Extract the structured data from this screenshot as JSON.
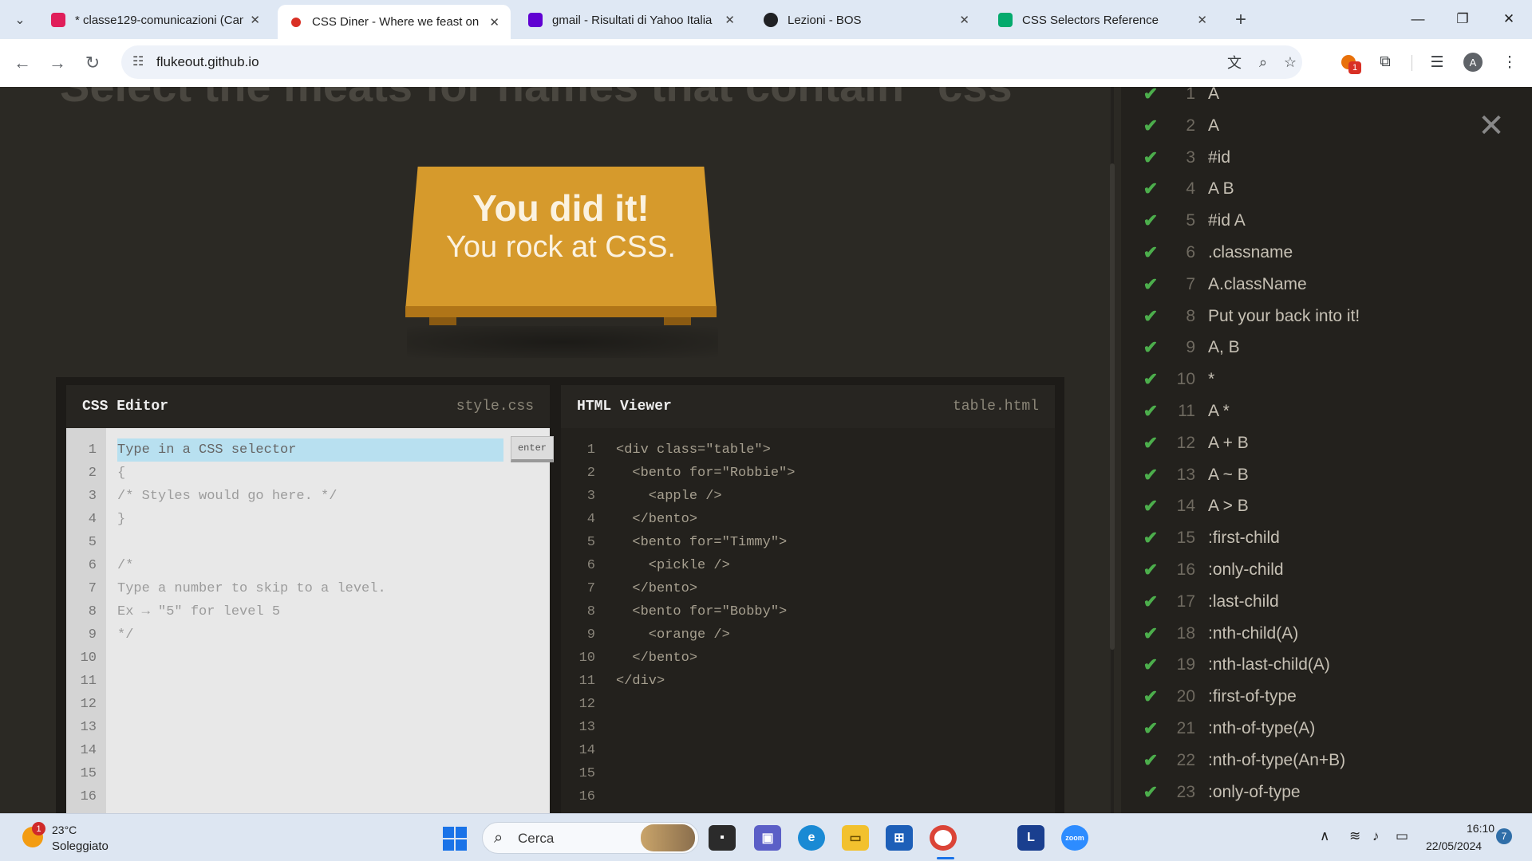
{
  "browser": {
    "tabs": [
      {
        "title": "* classe129-comunicazioni (Can",
        "icon": "slack-icon",
        "active": false
      },
      {
        "title": "CSS Diner - Where we feast on",
        "icon": "css-diner-icon",
        "active": true
      },
      {
        "title": "gmail - Risultati di Yahoo Italia",
        "icon": "yahoo-icon",
        "active": false
      },
      {
        "title": "Lezioni - BOS",
        "icon": "bos-icon",
        "active": false
      },
      {
        "title": "CSS Selectors Reference",
        "icon": "w3schools-icon",
        "active": false
      }
    ],
    "url": "flukeout.github.io",
    "extension_badge": "1",
    "profile_initial": "A"
  },
  "page": {
    "heading_fragment": "Select the meats for names that contain \"css\"",
    "win_title": "You did it!",
    "win_subtitle": "You rock at CSS.",
    "css_editor": {
      "label": "CSS Editor",
      "file": "style.css",
      "placeholder": "Type in a CSS selector",
      "enter_label": "enter",
      "lines": [
        "",
        "{",
        "/* Styles would go here. */",
        "}",
        "",
        "/*",
        "Type a number to skip to a level.",
        "Ex → \"5\" for level 5",
        "*/",
        "",
        "",
        "",
        "",
        "",
        "",
        ""
      ]
    },
    "html_viewer": {
      "label": "HTML Viewer",
      "file": "table.html",
      "lines": [
        "<div class=\"table\">",
        "  <bento for=\"Robbie\">",
        "    <apple />",
        "  </bento>",
        "  <bento for=\"Timmy\">",
        "    <pickle />",
        "  </bento>",
        "  <bento for=\"Bobby\">",
        "    <orange />",
        "  </bento>",
        "</div>",
        "",
        "",
        "",
        "",
        ""
      ]
    },
    "levels": [
      {
        "n": "1",
        "sel": "A",
        "done": true
      },
      {
        "n": "2",
        "sel": "A",
        "done": true
      },
      {
        "n": "3",
        "sel": "#id",
        "done": true
      },
      {
        "n": "4",
        "sel": "A  B",
        "done": true
      },
      {
        "n": "5",
        "sel": "#id  A",
        "done": true
      },
      {
        "n": "6",
        "sel": ".classname",
        "done": true
      },
      {
        "n": "7",
        "sel": "A.className",
        "done": true
      },
      {
        "n": "8",
        "sel": "Put your back into it!",
        "done": true
      },
      {
        "n": "9",
        "sel": "A, B",
        "done": true
      },
      {
        "n": "10",
        "sel": "*",
        "done": true
      },
      {
        "n": "11",
        "sel": "A *",
        "done": true
      },
      {
        "n": "12",
        "sel": "A + B",
        "done": true
      },
      {
        "n": "13",
        "sel": "A ~ B",
        "done": true
      },
      {
        "n": "14",
        "sel": "A > B",
        "done": true
      },
      {
        "n": "15",
        "sel": ":first-child",
        "done": true
      },
      {
        "n": "16",
        "sel": ":only-child",
        "done": true
      },
      {
        "n": "17",
        "sel": ":last-child",
        "done": true
      },
      {
        "n": "18",
        "sel": ":nth-child(A)",
        "done": true
      },
      {
        "n": "19",
        "sel": ":nth-last-child(A)",
        "done": true
      },
      {
        "n": "20",
        "sel": ":first-of-type",
        "done": true
      },
      {
        "n": "21",
        "sel": ":nth-of-type(A)",
        "done": true
      },
      {
        "n": "22",
        "sel": ":nth-of-type(An+B)",
        "done": true
      },
      {
        "n": "23",
        "sel": ":only-of-type",
        "done": true
      }
    ],
    "check_color": "#4cae4c"
  },
  "taskbar": {
    "weather_temp": "23°C",
    "weather_desc": "Soleggiato",
    "weather_badge": "1",
    "search_label": "Cerca",
    "time": "16:10",
    "date": "22/05/2024",
    "notifications": "7"
  }
}
